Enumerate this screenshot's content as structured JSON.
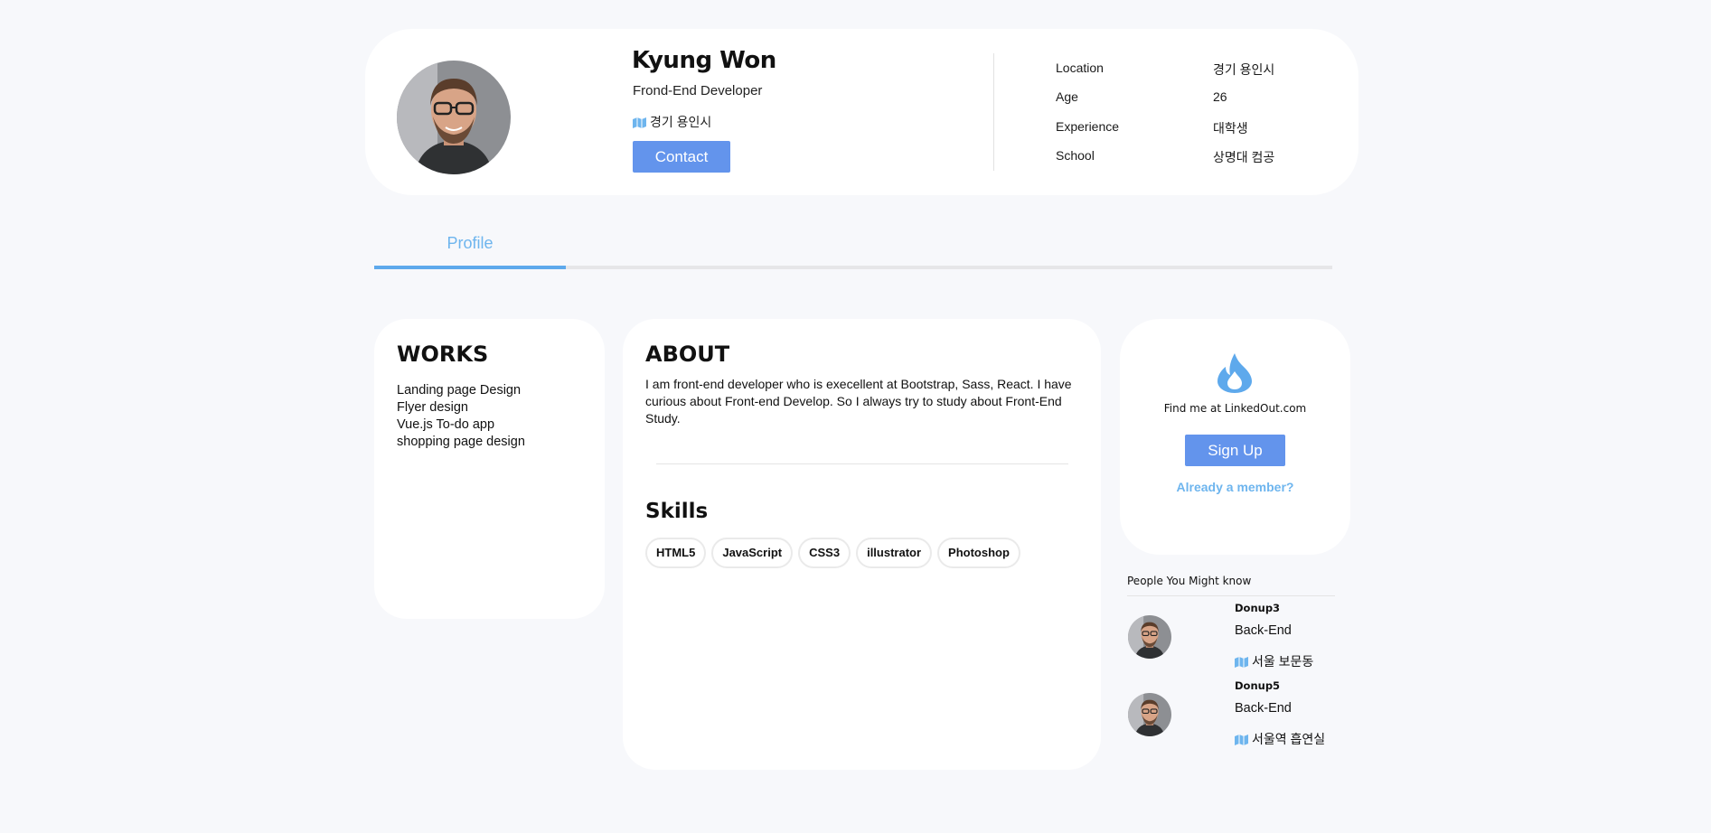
{
  "colors": {
    "page_bg": "#f7f8fb",
    "card_bg": "#ffffff",
    "button_bg": "#6394ec",
    "accent_blue": "#6eb5ee",
    "tab_indicator": "#5ea9ec"
  },
  "profile": {
    "name": "Kyung Won",
    "role": "Frond-End Developer",
    "location": "경기 용인시",
    "location_icon": "map-icon",
    "contact_label": "Contact",
    "avatar": "avatar-photo"
  },
  "info": {
    "items": [
      {
        "label": "Location",
        "value": "경기 용인시"
      },
      {
        "label": "Age",
        "value": "26"
      },
      {
        "label": "Experience",
        "value": "대학생"
      },
      {
        "label": "School",
        "value": "상명대 컴공"
      }
    ]
  },
  "tabs": [
    {
      "label": "Profile",
      "active": true
    }
  ],
  "works": {
    "title": "WORKS",
    "items": [
      "Landing page Design",
      "Flyer design",
      "Vue.js To-do app",
      "shopping page design"
    ]
  },
  "about": {
    "title": "ABOUT",
    "text": "I am front-end developer who is execellent at Bootstrap, Sass, React. I have curious about Front-end Develop. So I always try to study about Front-End Study."
  },
  "skills": {
    "title": "Skills",
    "items": [
      "HTML5",
      "JavaScript",
      "CSS3",
      "illustrator",
      "Photoshop"
    ]
  },
  "signup": {
    "icon": "flame-icon",
    "find_me": "Find me at LinkedOut.com",
    "button_label": "Sign Up",
    "member_link": "Already a member?"
  },
  "people": {
    "title": "People You Might know",
    "items": [
      {
        "name": "Donup3",
        "role": "Back-End",
        "location": "서울 보문동"
      },
      {
        "name": "Donup5",
        "role": "Back-End",
        "location": "서울역 흡연실"
      }
    ]
  }
}
